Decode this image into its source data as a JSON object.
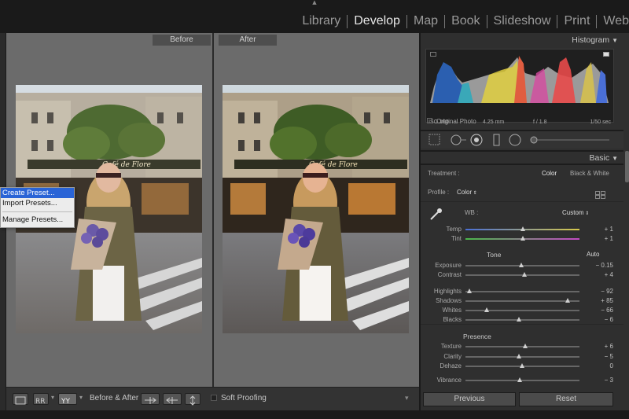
{
  "modules": [
    "Library",
    "Develop",
    "Map",
    "Book",
    "Slideshow",
    "Print",
    "Web"
  ],
  "active_module": "Develop",
  "preview": {
    "before_label": "Before",
    "after_label": "After"
  },
  "context_menu": [
    {
      "label": "Create Preset...",
      "selected": true
    },
    {
      "label": "Import Presets...",
      "selected": false
    },
    {
      "label": "Manage Presets...",
      "selected": false
    }
  ],
  "toolbar": {
    "before_after_label": "Before & After :",
    "soft_proofing_label": "Soft Proofing"
  },
  "histogram": {
    "title": "Histogram",
    "iso": "ISO 160",
    "focal": "4.25 mm",
    "aperture": "f / 1.8",
    "shutter": "1/50 sec",
    "original_photo": "Original Photo"
  },
  "basic": {
    "title": "Basic",
    "treatment_label": "Treatment :",
    "treatment_color": "Color",
    "treatment_bw": "Black & White",
    "profile_label": "Profile :",
    "profile_value": "Color",
    "wb_label": "WB :",
    "wb_value": "Custom",
    "tone_label": "Tone",
    "auto_label": "Auto",
    "presence_label": "Presence",
    "sliders": [
      {
        "name": "Temp",
        "value": "+ 1",
        "pos": 0.51,
        "group": "wb"
      },
      {
        "name": "Tint",
        "value": "+ 1",
        "pos": 0.51,
        "group": "wb"
      },
      {
        "name": "Exposure",
        "value": "− 0.15",
        "pos": 0.49,
        "group": "tone"
      },
      {
        "name": "Contrast",
        "value": "+ 4",
        "pos": 0.52,
        "group": "tone"
      },
      {
        "name": "Highlights",
        "value": "− 92",
        "pos": 0.04,
        "group": "tone2"
      },
      {
        "name": "Shadows",
        "value": "+ 85",
        "pos": 0.9,
        "group": "tone2"
      },
      {
        "name": "Whites",
        "value": "− 66",
        "pos": 0.19,
        "group": "tone2"
      },
      {
        "name": "Blacks",
        "value": "− 6",
        "pos": 0.47,
        "group": "tone2"
      },
      {
        "name": "Texture",
        "value": "+ 6",
        "pos": 0.53,
        "group": "presence"
      },
      {
        "name": "Clarity",
        "value": "− 5",
        "pos": 0.47,
        "group": "presence"
      },
      {
        "name": "Dehaze",
        "value": "0",
        "pos": 0.5,
        "group": "presence"
      },
      {
        "name": "Vibrance",
        "value": "− 3",
        "pos": 0.48,
        "group": "presence"
      }
    ]
  },
  "buttons": {
    "previous": "Previous",
    "reset": "Reset"
  }
}
